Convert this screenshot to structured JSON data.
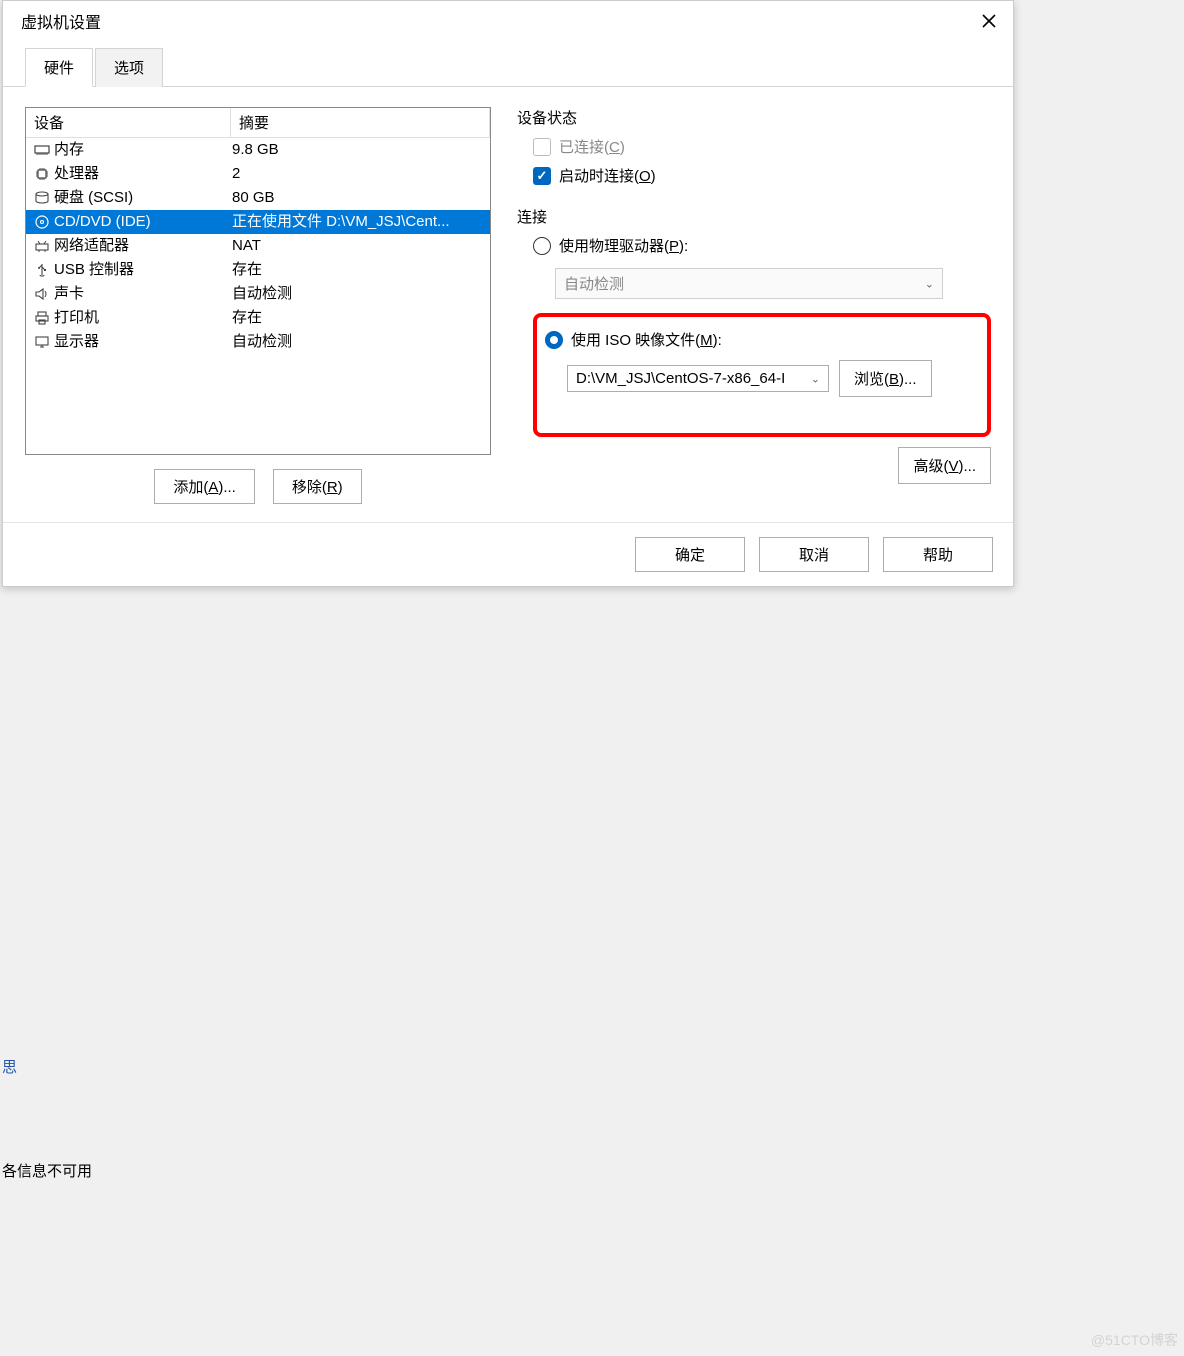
{
  "titlebar": {
    "title": "虚拟机设置",
    "close": "✕"
  },
  "tabs": {
    "hardware": "硬件",
    "options": "选项"
  },
  "table": {
    "header_device": "设备",
    "header_summary": "摘要",
    "rows": [
      {
        "icon": "memory",
        "device": "内存",
        "summary": "9.8 GB"
      },
      {
        "icon": "cpu",
        "device": "处理器",
        "summary": "2"
      },
      {
        "icon": "disk",
        "device": "硬盘 (SCSI)",
        "summary": "80 GB"
      },
      {
        "icon": "cd",
        "device": "CD/DVD (IDE)",
        "summary": "正在使用文件 D:\\VM_JSJ\\Cent..."
      },
      {
        "icon": "net",
        "device": "网络适配器",
        "summary": "NAT"
      },
      {
        "icon": "usb",
        "device": "USB 控制器",
        "summary": "存在"
      },
      {
        "icon": "sound",
        "device": "声卡",
        "summary": "自动检测"
      },
      {
        "icon": "printer",
        "device": "打印机",
        "summary": "存在"
      },
      {
        "icon": "display",
        "device": "显示器",
        "summary": "自动检测"
      }
    ],
    "add_button": "添加(A)...",
    "remove_button": "移除(R)"
  },
  "right": {
    "device_status": {
      "title": "设备状态",
      "connected": "已连接(C)",
      "connect_at_power_on": "启动时连接(O)"
    },
    "connection": {
      "title": "连接",
      "physical_drive": "使用物理驱动器(P):",
      "auto_detect": "自动检测",
      "use_iso": "使用 ISO 映像文件(M):",
      "iso_path": "D:\\VM_JSJ\\CentOS-7-x86_64-I",
      "browse": "浏览(B)...",
      "advanced": "高级(V)..."
    }
  },
  "footer": {
    "ok": "确定",
    "cancel": "取消",
    "help": "帮助"
  },
  "bg": {
    "line1": "思",
    "line2": "各信息不可用"
  },
  "watermark": "@51CTO博客"
}
